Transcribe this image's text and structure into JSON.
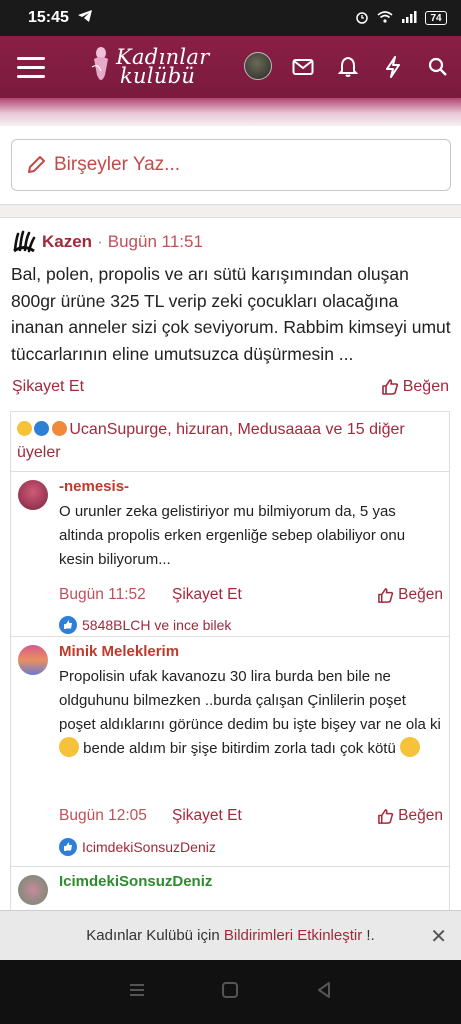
{
  "status_bar": {
    "time": "15:45",
    "battery": "74"
  },
  "app": {
    "logo_text_line1": "Kadınlar",
    "logo_text_line2": "kulübü",
    "brand_color": "#7a1a3d"
  },
  "composer": {
    "placeholder": "Birşeyler Yaz..."
  },
  "post": {
    "author": "Kazen",
    "separator": "·",
    "time": "Bugün 11:51",
    "body": "Bal, polen, propolis ve arı sütü karışımından oluşan 800gr ürüne 325 TL verip zeki çocukları olacağına inanan anneler sizi çok seviyorum. Rabbim kimseyi umut tüccarlarının eline umutsuzca düşürmesin ...",
    "report_label": "Şikayet Et",
    "like_label": "Beğen",
    "reactions_text": "UcanSupurge, hizuran, Medusaaaa ve 15 diğer üyeler"
  },
  "comments": [
    {
      "author": "-nemesis-",
      "author_color": "#c0392b",
      "text": "O urunler zeka gelistiriyor mu bilmiyorum da, 5 yas altinda propolis erken ergenliğe sebep olabiliyor onu kesin biliyorum...",
      "time": "Bugün 11:52",
      "report_label": "Şikayet Et",
      "like_label": "Beğen",
      "likes": "5848BLCH ve ince bilek"
    },
    {
      "author": "Minik Meleklerim",
      "author_color": "#c0392b",
      "text_part1": "Propolisin ufak kavanozu 30 lira burda ben bile ne oldguhunu bilmezken ..burda çalışan Çinlilerin poşet poşet aldıklarını görünce dedim bu işte bişey var ne ola ki",
      "text_part2": "bende aldım bir şişe bitirdim zorla tadı çok kötü",
      "time": "Bugün 12:05",
      "report_label": "Şikayet Et",
      "like_label": "Beğen",
      "likes": "IcimdekiSonsuzDeniz"
    },
    {
      "author": "IcimdekiSonsuzDeniz",
      "author_color": "#2e8b2e"
    }
  ],
  "notification": {
    "prefix": "Kadınlar Kulübü için",
    "link": "Bildirimleri Etkinleştir",
    "suffix": "!.",
    "close": "✕"
  }
}
